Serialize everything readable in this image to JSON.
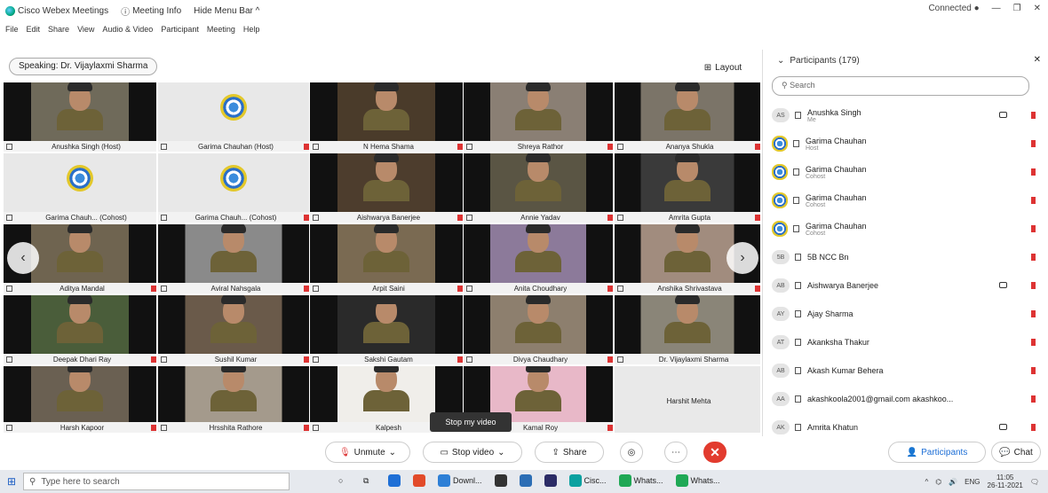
{
  "titlebar": {
    "app_name": "Cisco Webex Meetings",
    "meeting_info": "Meeting Info",
    "hide_menu": "Hide Menu Bar ^",
    "connected": "Connected ●",
    "window_controls": [
      "—",
      "❐",
      "✕"
    ]
  },
  "menubar": [
    "File",
    "Edit",
    "Share",
    "View",
    "Audio & Video",
    "Participant",
    "Meeting",
    "Help"
  ],
  "speaking": "Speaking: Dr. Vijaylaxmi Sharma",
  "layout_button": "Layout",
  "tiles": [
    {
      "name": "Anushka Singh (Host)",
      "kind": "video",
      "bg": "#6f6a5a",
      "muted": false
    },
    {
      "name": "Garima Chauhan (Host)",
      "kind": "logo",
      "muted": true
    },
    {
      "name": "N Hema Shama",
      "kind": "video",
      "bg": "#4a3b2a",
      "muted": true
    },
    {
      "name": "Shreya Rathor",
      "kind": "video",
      "bg": "#8a7f74",
      "muted": true
    },
    {
      "name": "Ananya Shukla",
      "kind": "video",
      "bg": "#7b7468",
      "muted": true
    },
    {
      "name": "Garima Chauh... (Cohost)",
      "kind": "logo",
      "muted": false
    },
    {
      "name": "Garima Chauh... (Cohost)",
      "kind": "logo",
      "muted": true
    },
    {
      "name": "Aishwarya Banerjee",
      "kind": "video",
      "bg": "#4d3d2d",
      "muted": true
    },
    {
      "name": "Annie Yadav",
      "kind": "video",
      "bg": "#5a5544",
      "muted": true
    },
    {
      "name": "Amrita Gupta",
      "kind": "video",
      "bg": "#3a3a3a",
      "muted": true
    },
    {
      "name": "Aditya Mandal",
      "kind": "video",
      "bg": "#6f6450",
      "muted": true
    },
    {
      "name": "Aviral Nahsgala",
      "kind": "video",
      "bg": "#8a8a8a",
      "muted": true
    },
    {
      "name": "Arpit Saini",
      "kind": "video",
      "bg": "#7a6a52",
      "muted": true
    },
    {
      "name": "Anita Choudhary",
      "kind": "video",
      "bg": "#8c7a9a",
      "muted": true
    },
    {
      "name": "Anshika Shrivastava",
      "kind": "video",
      "bg": "#a18c7e",
      "muted": true
    },
    {
      "name": "Deepak Dhari Ray",
      "kind": "video",
      "bg": "#4a5d3a",
      "muted": true
    },
    {
      "name": "Sushil Kumar",
      "kind": "video",
      "bg": "#6a5a4a",
      "muted": true
    },
    {
      "name": "Sakshi Gautam",
      "kind": "video",
      "bg": "#2a2a2a",
      "muted": true
    },
    {
      "name": "Divya Chaudhary",
      "kind": "video",
      "bg": "#8d7f6e",
      "muted": true
    },
    {
      "name": "Dr. Vijaylaxmi Sharma",
      "kind": "video",
      "bg": "#8a8578",
      "muted": false,
      "active": true
    },
    {
      "name": "Harsh Kapoor",
      "kind": "video",
      "bg": "#6a6052",
      "muted": true
    },
    {
      "name": "Hrsshita Rathore",
      "kind": "video",
      "bg": "#a49a8c",
      "muted": true
    },
    {
      "name": "Kalpesh",
      "kind": "video",
      "bg": "#f0eeea",
      "muted": true
    },
    {
      "name": "Kamal Roy",
      "kind": "video",
      "bg": "#e8b8c8",
      "muted": true
    },
    {
      "name": "Harshit Mehta",
      "kind": "empty",
      "muted": false
    }
  ],
  "tooltip": "Stop my video",
  "participants_panel": {
    "title": "Participants (179)",
    "search_placeholder": "Search",
    "rows": [
      {
        "initials": "AS",
        "name": "Anushka Singh",
        "sub": "Me",
        "video": true,
        "avatar_img": false
      },
      {
        "initials": "",
        "name": "Garima Chauhan",
        "sub": "Host",
        "video": false,
        "avatar_img": true
      },
      {
        "initials": "",
        "name": "Garima Chauhan",
        "sub": "Cohost",
        "video": false,
        "avatar_img": true
      },
      {
        "initials": "",
        "name": "Garima Chauhan",
        "sub": "Cohost",
        "video": false,
        "avatar_img": true
      },
      {
        "initials": "",
        "name": "Garima Chauhan",
        "sub": "Cohost",
        "video": false,
        "avatar_img": true
      },
      {
        "initials": "5B",
        "name": "5B NCC Bn",
        "sub": "",
        "video": false,
        "avatar_img": false
      },
      {
        "initials": "AB",
        "name": "Aishwarya Banerjee",
        "sub": "",
        "video": true,
        "avatar_img": false
      },
      {
        "initials": "AY",
        "name": "Ajay Sharma",
        "sub": "",
        "video": false,
        "avatar_img": false
      },
      {
        "initials": "AT",
        "name": "Akanksha Thakur",
        "sub": "",
        "video": false,
        "avatar_img": false
      },
      {
        "initials": "AB",
        "name": "Akash Kumar Behera",
        "sub": "",
        "video": false,
        "avatar_img": false
      },
      {
        "initials": "AA",
        "name": "akashkoola2001@gmail.com akashkoo...",
        "sub": "",
        "video": false,
        "avatar_img": false
      },
      {
        "initials": "AK",
        "name": "Amrita Khatun",
        "sub": "",
        "video": true,
        "avatar_img": false
      }
    ]
  },
  "controls": {
    "unmute": "Unmute",
    "stop_video": "Stop video",
    "share": "Share",
    "participants": "Participants",
    "chat": "Chat"
  },
  "taskbar": {
    "search_placeholder": "Type here to search",
    "apps": [
      {
        "label": "",
        "color": "#1e6fd6"
      },
      {
        "label": "",
        "color": "#e24b2a"
      },
      {
        "label": "Downl...",
        "color": "#2d7fd6"
      },
      {
        "label": "",
        "color": "#333333"
      },
      {
        "label": "",
        "color": "#2c6eb5"
      },
      {
        "label": "",
        "color": "#2c2c66"
      },
      {
        "label": "Cisc...",
        "color": "#0aa1a0"
      },
      {
        "label": "Whats...",
        "color": "#1fa855"
      },
      {
        "label": "Whats...",
        "color": "#1fa855"
      }
    ],
    "language": "ENG",
    "time": "11:05",
    "date": "26-11-2021"
  }
}
